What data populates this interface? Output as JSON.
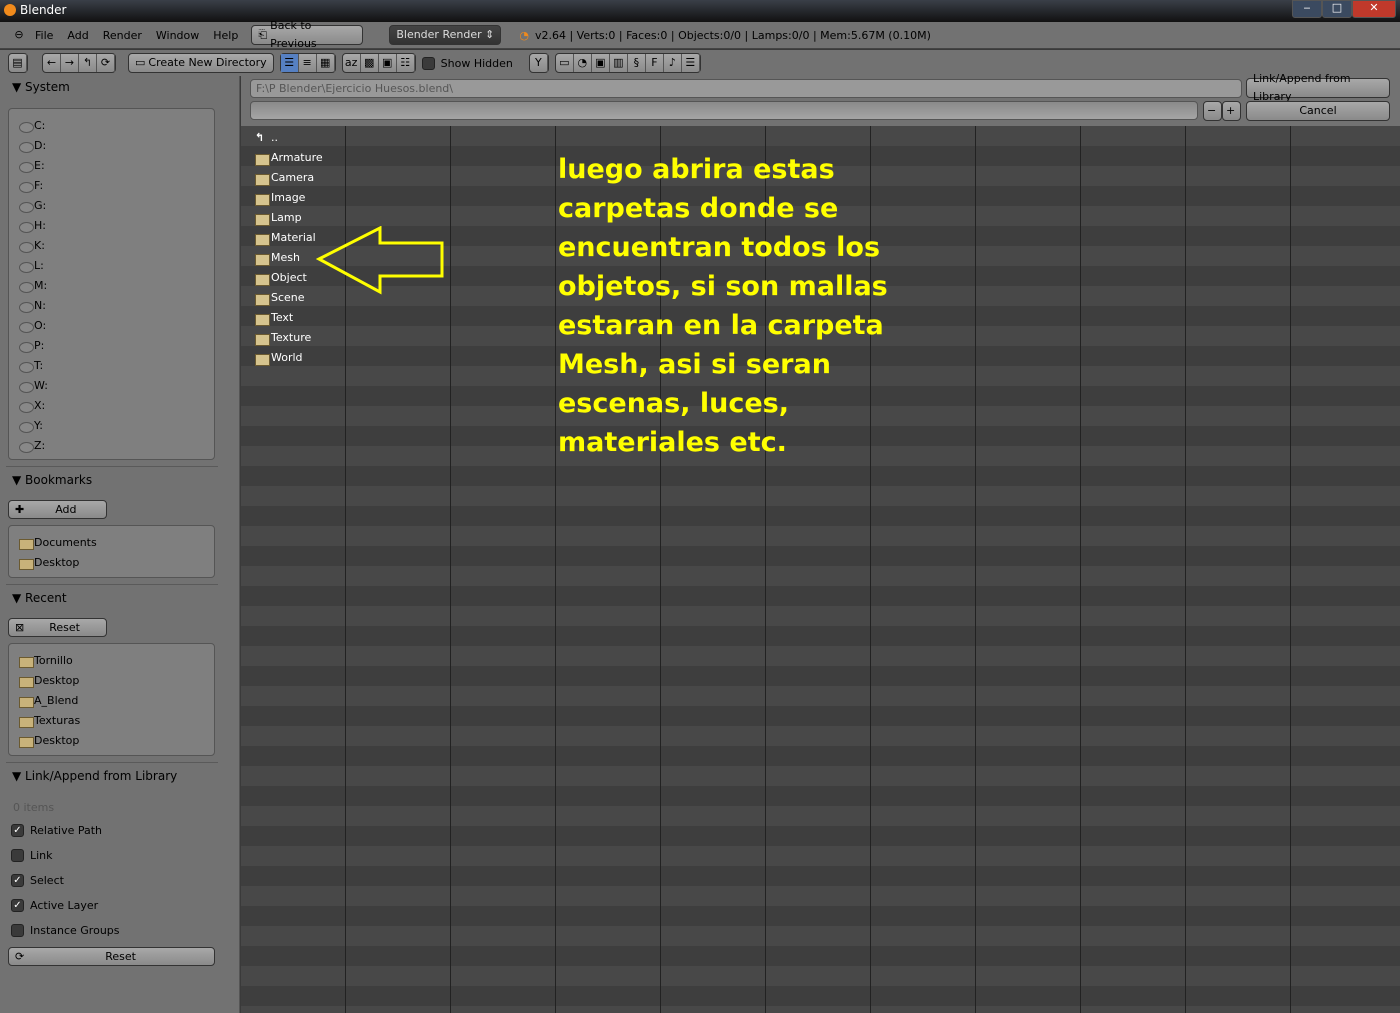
{
  "window": {
    "title": "Blender",
    "minimize": "‒",
    "maximize": "□",
    "close": "✕"
  },
  "menu": {
    "items": [
      "File",
      "Add",
      "Render",
      "Window",
      "Help"
    ],
    "back": "Back to Previous",
    "engine": "Blender Render",
    "stats": "v2.64 | Verts:0 | Faces:0 | Objects:0/0 | Lamps:0/0 | Mem:5.67M (0.10M)"
  },
  "toolbar": {
    "create_dir": "Create New Directory",
    "show_hidden": "Show Hidden"
  },
  "system": {
    "title": "System",
    "drives": [
      "C:",
      "D:",
      "E:",
      "F:",
      "G:",
      "H:",
      "K:",
      "L:",
      "M:",
      "N:",
      "O:",
      "P:",
      "T:",
      "W:",
      "X:",
      "Y:",
      "Z:"
    ]
  },
  "bookmarks": {
    "title": "Bookmarks",
    "add": "Add",
    "items": [
      "Documents",
      "Desktop"
    ]
  },
  "recent": {
    "title": "Recent",
    "reset": "Reset",
    "items": [
      "Tornillo",
      "Desktop",
      "A_Blend",
      "Texturas",
      "Desktop"
    ]
  },
  "link": {
    "title": "Link/Append from Library",
    "count": "0 items",
    "options": [
      {
        "label": "Relative Path",
        "checked": true
      },
      {
        "label": "Link",
        "checked": false
      },
      {
        "label": "Select",
        "checked": true
      },
      {
        "label": "Active Layer",
        "checked": true
      },
      {
        "label": "Instance Groups",
        "checked": false
      }
    ],
    "reset": "Reset"
  },
  "path": {
    "directory": "F:\\P Blender\\Ejercicio  Huesos.blend\\",
    "filename": "",
    "action": "Link/Append from Library",
    "cancel": "Cancel"
  },
  "files": {
    "parent": "..",
    "items": [
      "Armature",
      "Camera",
      "Image",
      "Lamp",
      "Material",
      "Mesh",
      "Object",
      "Scene",
      "Text",
      "Texture",
      "World"
    ]
  },
  "annotation": {
    "lines": [
      "luego abrira estas",
      "carpetas donde se",
      "encuentran todos los",
      "objetos, si son mallas",
      "estaran en la carpeta",
      "Mesh, asi si seran",
      "escenas, luces,",
      "materiales etc."
    ],
    "color": "#ffff00"
  }
}
